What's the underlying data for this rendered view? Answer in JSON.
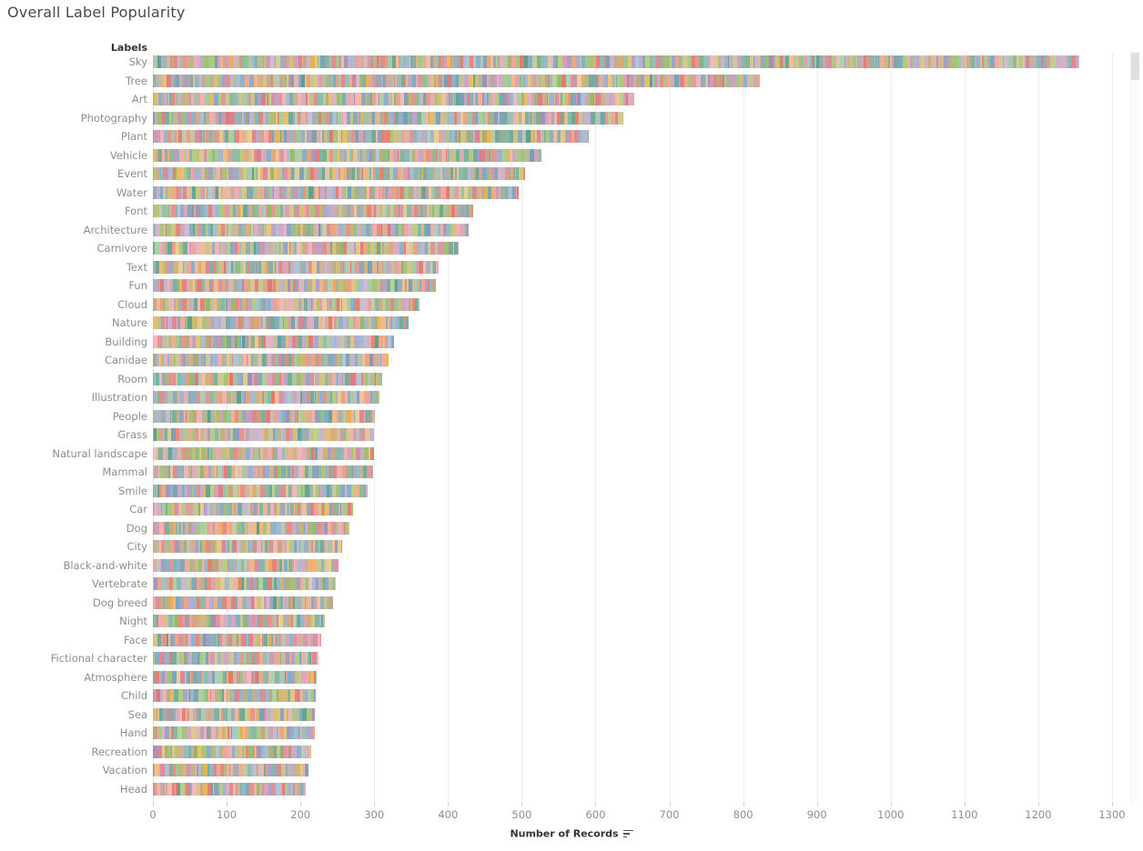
{
  "title": "Overall Label Popularity",
  "labels_header": "Labels",
  "axis": {
    "title": "Number of Records",
    "sort_icon": "sort-descending-icon",
    "ticks": [
      0,
      100,
      200,
      300,
      400,
      500,
      600,
      700,
      800,
      900,
      1000,
      1100,
      1200,
      1300
    ]
  },
  "chart_data": {
    "type": "bar",
    "orientation": "horizontal",
    "title": "Overall Label Popularity",
    "xlabel": "Number of Records",
    "ylabel": "Labels",
    "xlim": [
      0,
      1300
    ],
    "grid": true,
    "legend": "none",
    "note": "Each bar is subdivided into many thin colored segments (one per contributing record/source), Tableau-20 pastel palette.",
    "categories": [
      "Sky",
      "Tree",
      "Art",
      "Photography",
      "Plant",
      "Vehicle",
      "Event",
      "Water",
      "Font",
      "Architecture",
      "Carnivore",
      "Text",
      "Fun",
      "Cloud",
      "Nature",
      "Building",
      "Canidae",
      "Room",
      "Illustration",
      "People",
      "Grass",
      "Natural landscape",
      "Mammal",
      "Smile",
      "Car",
      "Dog",
      "City",
      "Black-and-white",
      "Vertebrate",
      "Dog breed",
      "Night",
      "Face",
      "Fictional character",
      "Atmosphere",
      "Child",
      "Sea",
      "Hand",
      "Recreation",
      "Vacation",
      "Head"
    ],
    "values": [
      1256,
      823,
      652,
      638,
      591,
      527,
      504,
      496,
      434,
      428,
      414,
      387,
      383,
      362,
      347,
      327,
      320,
      311,
      307,
      301,
      300,
      300,
      298,
      291,
      271,
      267,
      256,
      252,
      248,
      244,
      233,
      228,
      224,
      222,
      221,
      220,
      219,
      215,
      211,
      207
    ]
  },
  "scrollbar": {
    "name": "vertical-scrollbar",
    "thumb_position": "top"
  },
  "colors": {
    "axis_text": "#8d8d8d",
    "header_text": "#333333",
    "title_text": "#4a4a4a",
    "gridline": "#ededed",
    "palette": [
      "#72a898",
      "#f0a2a0",
      "#c0a8c8",
      "#8fbb5e",
      "#e8b04b",
      "#7fa8c8",
      "#e3776f",
      "#9fc2a0",
      "#d6a4b8",
      "#b6ab8d",
      "#5b9e8a",
      "#f4b183",
      "#a7c36a",
      "#d98f8f",
      "#8f9fc0",
      "#c9b06a",
      "#6fa3b8",
      "#e89f7a",
      "#bdbd8a",
      "#cf8fa8",
      "#89b07a",
      "#e5c07b",
      "#9a8fb8",
      "#d9787c",
      "#7bb3a0",
      "#e8a37d",
      "#b8a0c4",
      "#a3bd72",
      "#d87f8f",
      "#8ab0cb",
      "#c8a27a",
      "#6ea88f",
      "#efa8b2",
      "#9fb8d0",
      "#cfc07a",
      "#7f9fb0",
      "#e07f6f",
      "#a0c890",
      "#c89fb8",
      "#b0a878"
    ]
  }
}
